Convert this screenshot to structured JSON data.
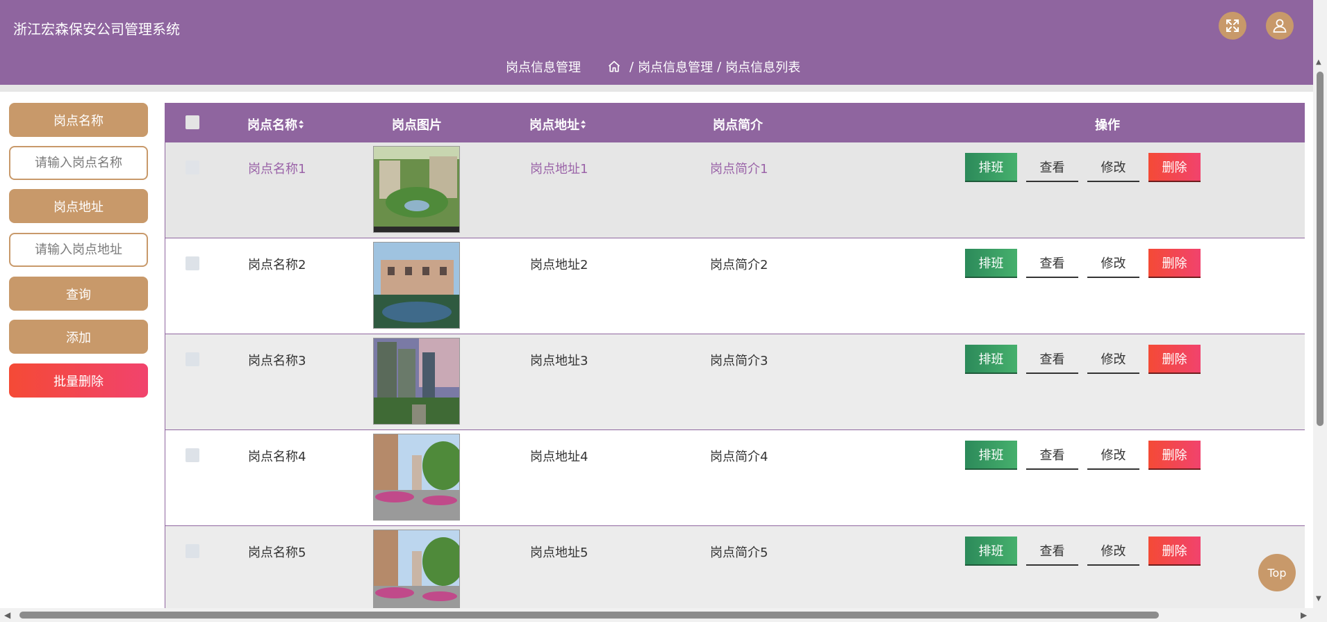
{
  "header": {
    "title": "浙江宏森保安公司管理系统",
    "page_name": "岗点信息管理",
    "breadcrumb": [
      "岗点信息管理",
      "岗点信息列表"
    ],
    "breadcrumb_sep": "/",
    "accent_color": "#8f659f",
    "button_color": "#c8996a"
  },
  "sidebar": {
    "name_label": "岗点名称",
    "name_placeholder": "请输入岗点名称",
    "addr_label": "岗点地址",
    "addr_placeholder": "请输入岗点地址",
    "search_label": "查询",
    "add_label": "添加",
    "batch_delete_label": "批量删除"
  },
  "table": {
    "columns": [
      "岗点名称",
      "岗点图片",
      "岗点地址",
      "岗点简介",
      "操作"
    ],
    "rows": [
      {
        "name": "岗点名称1",
        "address": "岗点地址1",
        "intro": "岗点简介1"
      },
      {
        "name": "岗点名称2",
        "address": "岗点地址2",
        "intro": "岗点简介2"
      },
      {
        "name": "岗点名称3",
        "address": "岗点地址3",
        "intro": "岗点简介3"
      },
      {
        "name": "岗点名称4",
        "address": "岗点地址4",
        "intro": "岗点简介4"
      },
      {
        "name": "岗点名称5",
        "address": "岗点地址5",
        "intro": "岗点简介5"
      }
    ],
    "actions": {
      "schedule": "排班",
      "view": "查看",
      "edit": "修改",
      "delete": "删除"
    }
  },
  "top_button": "Top",
  "icons": {
    "fullscreen": "fullscreen-icon",
    "user": "user-icon",
    "home": "home-icon",
    "sort": "sort-icon"
  }
}
